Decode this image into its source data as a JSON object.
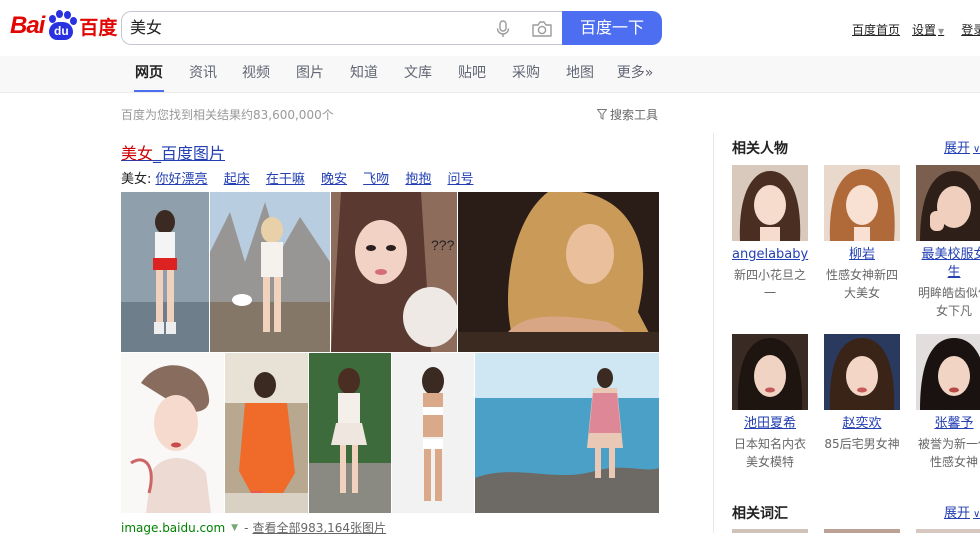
{
  "header": {
    "logo_text_left": "Bai",
    "logo_text_paw": "du",
    "logo_text_cn": "百度",
    "search_value": "美女",
    "search_button_label": "百度一下",
    "links": {
      "home": "百度首页",
      "settings": "设置",
      "login": "登录"
    }
  },
  "tabs": [
    {
      "label": "网页",
      "active": true
    },
    {
      "label": "资讯"
    },
    {
      "label": "视频"
    },
    {
      "label": "图片"
    },
    {
      "label": "知道"
    },
    {
      "label": "文库"
    },
    {
      "label": "贴吧"
    },
    {
      "label": "采购"
    },
    {
      "label": "地图"
    },
    {
      "label": "更多»"
    }
  ],
  "results_info": {
    "count_text": "百度为您找到相关结果约83,600,000个",
    "tools_label": "搜索工具"
  },
  "image_result": {
    "title_highlight": "美女",
    "title_rest": "_百度图片",
    "sub_label": "美女:",
    "sub_links": [
      "你好漂亮",
      "起床",
      "在干嘛",
      "晚安",
      "飞吻",
      "抱抱",
      "问号"
    ],
    "source_url": "image.baidu.com",
    "dash": "-",
    "view_all": "查看全部983,164张图片",
    "image_overlay_text": "???"
  },
  "sidebar": {
    "people_title": "相关人物",
    "expand_label": "展开",
    "people": [
      {
        "name": "angelababy",
        "desc": "新四小花旦之一"
      },
      {
        "name": "柳岩",
        "desc": "性感女神新四大美女"
      },
      {
        "name": "最美校服女生",
        "desc": "明眸皓齿似仙女下凡"
      },
      {
        "name": "池田夏希",
        "desc": "日本知名内衣美女模特"
      },
      {
        "name": "赵奕欢",
        "desc": "85后宅男女神"
      },
      {
        "name": "张馨予",
        "desc": "被誉为新一代性感女神"
      }
    ],
    "words_title": "相关词汇",
    "words_expand_label": "展开"
  }
}
